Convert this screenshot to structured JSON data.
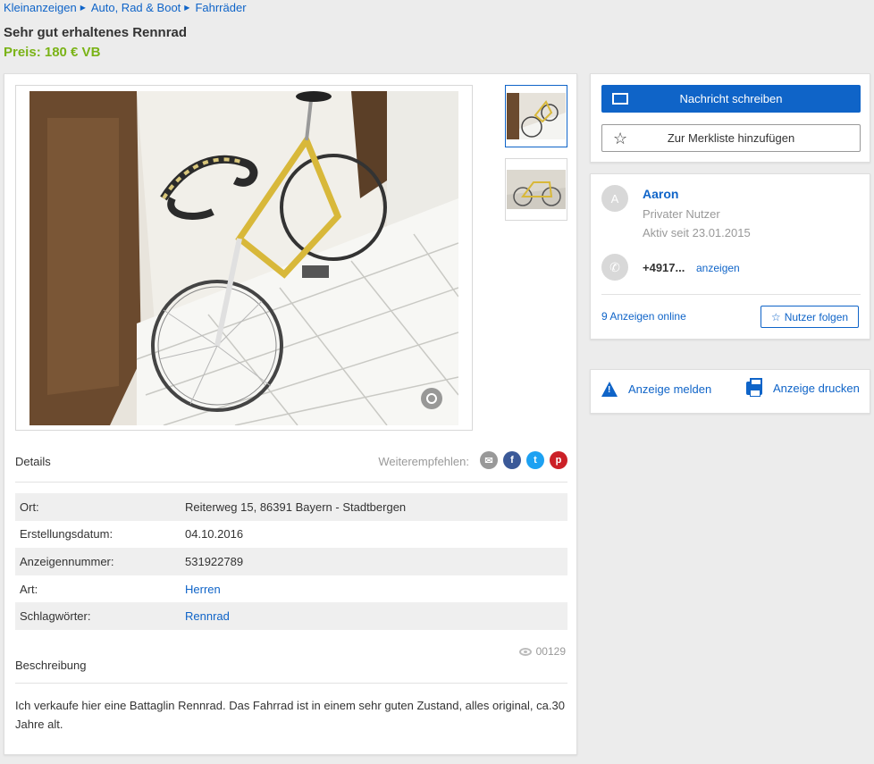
{
  "breadcrumb": [
    "Kleinanzeigen",
    "Auto, Rad & Boot",
    "Fahrräder"
  ],
  "listing": {
    "title": "Sehr gut erhaltenes Rennrad",
    "price": "Preis: 180 € VB"
  },
  "gallery": {
    "main_image": "bicycle-photo",
    "thumbnails": [
      "bicycle-thumb-1",
      "bicycle-thumb-2"
    ]
  },
  "details": {
    "heading": "Details",
    "share_label": "Weiterempfehlen:",
    "rows": [
      {
        "key": "Ort:",
        "value": "Reiterweg 15, 86391 Bayern - Stadtbergen"
      },
      {
        "key": "Erstellungsdatum:",
        "value": "04.10.2016"
      },
      {
        "key": "Anzeigennummer:",
        "value": "531922789"
      },
      {
        "key": "Art:",
        "value": "Herren"
      },
      {
        "key": "Schlagwörter:",
        "value": "Rennrad"
      }
    ],
    "views": "00129"
  },
  "description": {
    "heading": "Beschreibung",
    "text": "Ich verkaufe hier eine Battaglin Rennrad. Das Fahrrad ist in einem sehr guten Zustand, alles original, ca.30 Jahre alt."
  },
  "actions": {
    "message": "Nachricht schreiben",
    "watchlist": "Zur Merkliste hinzufügen"
  },
  "seller": {
    "initial": "A",
    "name": "Aaron",
    "type": "Privater Nutzer",
    "since": "Aktiv seit 23.01.2015",
    "phone": "+4917...",
    "phone_show": "anzeigen",
    "ads_online": "9 Anzeigen online",
    "follow": "Nutzer folgen"
  },
  "footer_actions": {
    "report": "Anzeige melden",
    "print": "Anzeige drucken"
  },
  "colors": {
    "accent": "#0f64c8",
    "price": "#7ab317"
  }
}
